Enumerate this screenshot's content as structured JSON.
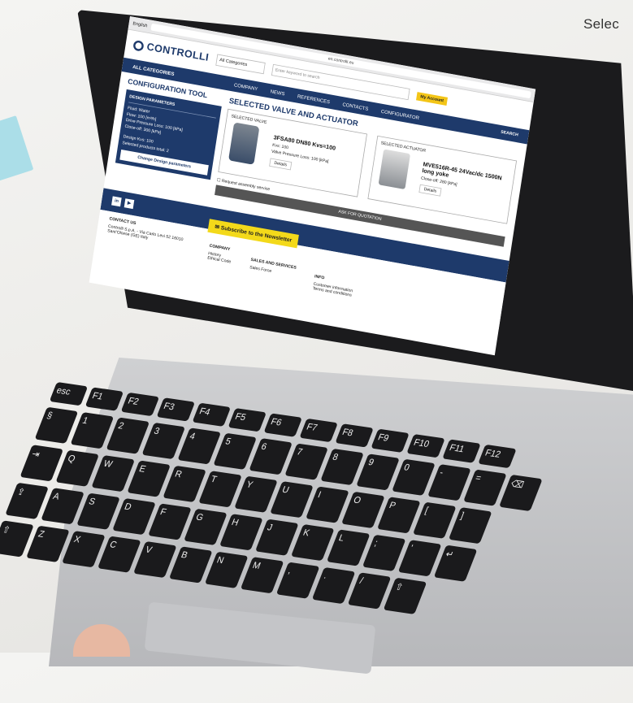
{
  "side_text": "Selec",
  "browser": {
    "language": "English",
    "url": "en.controlli.eu"
  },
  "site": {
    "logo_text": "CONTROLLI",
    "category_select": "All Categories",
    "search_placeholder": "Enter keyword to search",
    "search_button": "SEARCH",
    "my_account": "My Account",
    "all_categories": "ALL CATEGORIES",
    "nav": [
      "COMPANY",
      "NEWS",
      "REFERENCES",
      "CONTACTS",
      "CONFIGURATOR"
    ]
  },
  "config": {
    "title": "CONFIGURATION TOOL",
    "panel_title": "DESIGN PARAMETERS",
    "lines": [
      "Fluid: Water",
      "Flow: 100 [m³/h]",
      "Drive Pressure Loss: 100 [kPa]",
      "Close-off: 300 [kPa]",
      "",
      "Design Kvs: 100",
      "Selected products total: 2"
    ],
    "change_button": "Change Design parameters"
  },
  "selection": {
    "title": "SELECTED VALVE AND ACTUATOR",
    "valve": {
      "label": "SELECTED VALVE",
      "name": "3FSA80 DN80 Kvs=100",
      "line1": "Kvs: 100",
      "line2": "Valve Pressure Loss: 100 [kPa]",
      "details": "Details"
    },
    "actuator": {
      "label": "SELECTED ACTUATOR",
      "name": "MVE516R-45 24Vac/dc 1500N long yoke",
      "line1": "Close-off: 280 [kPa]",
      "details": "Details"
    },
    "assembly": "Request assembly service",
    "quote": "ASK FOR QUOTATION"
  },
  "footer": {
    "social": [
      "in",
      "▶"
    ],
    "newsletter": "Subscribe to the Newsletter",
    "contact_title": "CONTACT US",
    "contact_line": "Controlli S.p.A. - Via Carlo Levi 52 16010 Sant'Olcese (GE) Italy",
    "company_title": "COMPANY",
    "company_items": [
      "History",
      "Ethical Code"
    ],
    "sales_title": "SALES AND SERVICES",
    "sales_items": [
      "Sales Force"
    ],
    "info_title": "INFO",
    "info_items": [
      "Customer information",
      "Terms and conditions"
    ]
  },
  "keyboard": {
    "row1": [
      "esc",
      "F1",
      "F2",
      "F3",
      "F4",
      "F5",
      "F6",
      "F7",
      "F8",
      "F9",
      "F10",
      "F11",
      "F12"
    ],
    "row2": [
      "§",
      "1",
      "2",
      "3",
      "4",
      "5",
      "6",
      "7",
      "8",
      "9",
      "0",
      "-",
      "=",
      "⌫"
    ],
    "row3": [
      "⇥",
      "Q",
      "W",
      "E",
      "R",
      "T",
      "Y",
      "U",
      "I",
      "O",
      "P",
      "[",
      "]"
    ],
    "row4": [
      "⇪",
      "A",
      "S",
      "D",
      "F",
      "G",
      "H",
      "J",
      "K",
      "L",
      ";",
      "'",
      "↵"
    ],
    "row5": [
      "⇧",
      "Z",
      "X",
      "C",
      "V",
      "B",
      "N",
      "M",
      ",",
      ".",
      "/",
      "⇧"
    ]
  }
}
